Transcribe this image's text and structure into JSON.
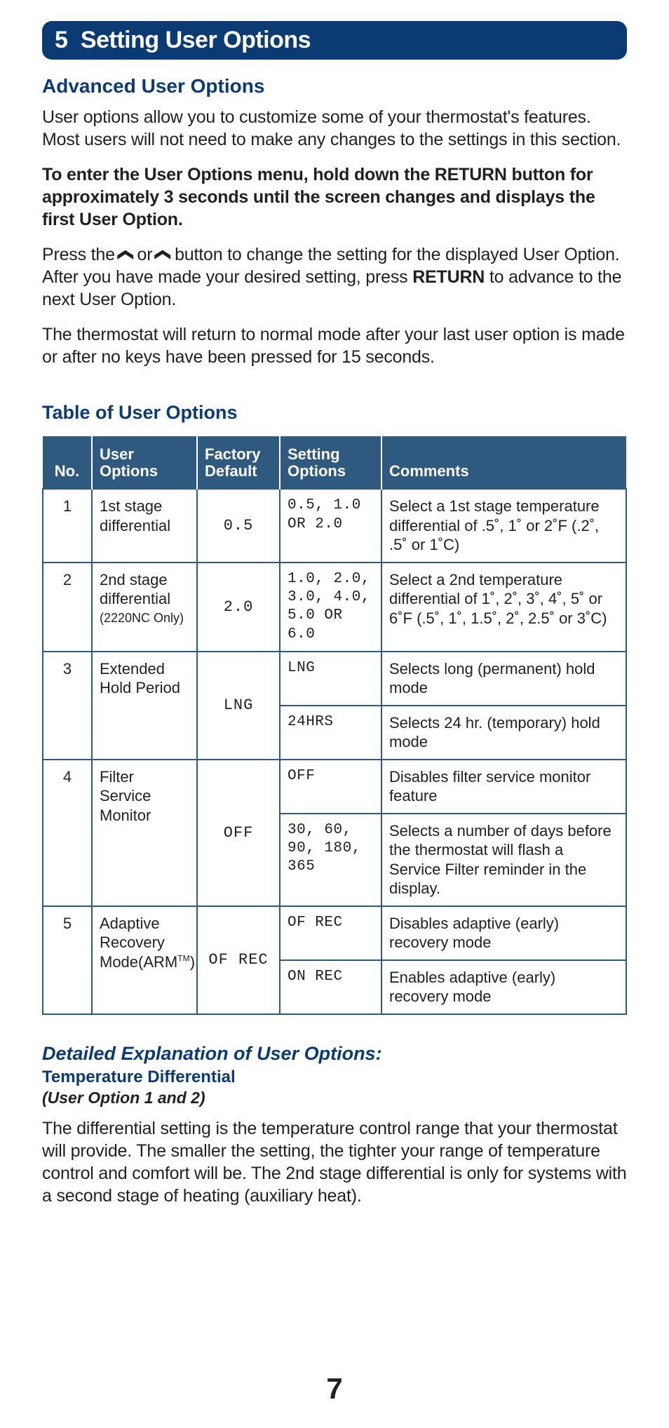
{
  "section": {
    "number": "5",
    "title": "Setting User Options"
  },
  "advanced": {
    "heading": "Advanced User Options",
    "p1": "User options allow you to customize some of your thermostat's features. Most users will not need to make any changes to the settings in this section.",
    "p2": "To enter the User Options menu, hold down the RETURN button for approximately 3 seconds until the screen changes and displays the first User Option.",
    "p3_a": "Press the ",
    "p3_b": " or ",
    "p3_c": " button to change the setting for the displayed User Option. After you have made your desired setting, press ",
    "p3_return": "RETURN",
    "p3_d": " to advance to the next User Option.",
    "p4": "The thermostat will return to normal mode after your last user option is made or after no keys have been pressed for 15 seconds."
  },
  "table": {
    "heading": "Table of User Options",
    "headers": {
      "no": "No.",
      "user_options": "User Options",
      "factory_default": "Factory Default",
      "setting_options": "Setting Options",
      "comments": "Comments"
    },
    "rows": [
      {
        "no": "1",
        "option": "1st stage differential",
        "default": "0.5",
        "settings": [
          {
            "value": "0.5, 1.0 OR 2.0",
            "comment": "Select a 1st stage temperature differential of .5˚, 1˚ or 2˚F (.2˚, .5˚ or 1˚C)"
          }
        ]
      },
      {
        "no": "2",
        "option": "2nd stage differential",
        "option_note": "(2220NC Only)",
        "default": "2.0",
        "settings": [
          {
            "value": "1.0, 2.0, 3.0, 4.0, 5.0 OR 6.0",
            "comment": "Select a 2nd temperature differential of 1˚, 2˚, 3˚, 4˚, 5˚ or 6˚F (.5˚, 1˚, 1.5˚, 2˚, 2.5˚ or 3˚C)"
          }
        ]
      },
      {
        "no": "3",
        "option": "Extended Hold Period",
        "default": "LNG",
        "settings": [
          {
            "value": "LNG",
            "comment": "Selects long (permanent) hold mode"
          },
          {
            "value": "24HRS",
            "comment": "Selects 24 hr. (temporary) hold mode"
          }
        ]
      },
      {
        "no": "4",
        "option": "Filter Service Monitor",
        "default": "OFF",
        "settings": [
          {
            "value": "OFF",
            "comment": "Disables filter service monitor feature"
          },
          {
            "value": "30, 60, 90, 180, 365",
            "comment": "Selects a number of days before the thermostat will flash a Service Filter reminder in the display."
          }
        ]
      },
      {
        "no": "5",
        "option": "Adaptive Recovery Mode(ARM™)",
        "default": "OF REC",
        "settings": [
          {
            "value": "OF REC",
            "comment": "Disables adaptive (early) recovery mode"
          },
          {
            "value": "ON REC",
            "comment": "Enables adaptive (early) recovery mode"
          }
        ]
      }
    ]
  },
  "detail": {
    "heading": "Detailed Explanation of User Options:",
    "sub": "Temperature Differential",
    "note": "(User Option 1 and 2)",
    "body": "The differential setting is the temperature control range that your thermostat will provide. The smaller the setting, the tighter your range of temperature control and comfort will be. The 2nd stage differential is only for systems with a second stage of heating (auxiliary heat)."
  },
  "page": "7"
}
